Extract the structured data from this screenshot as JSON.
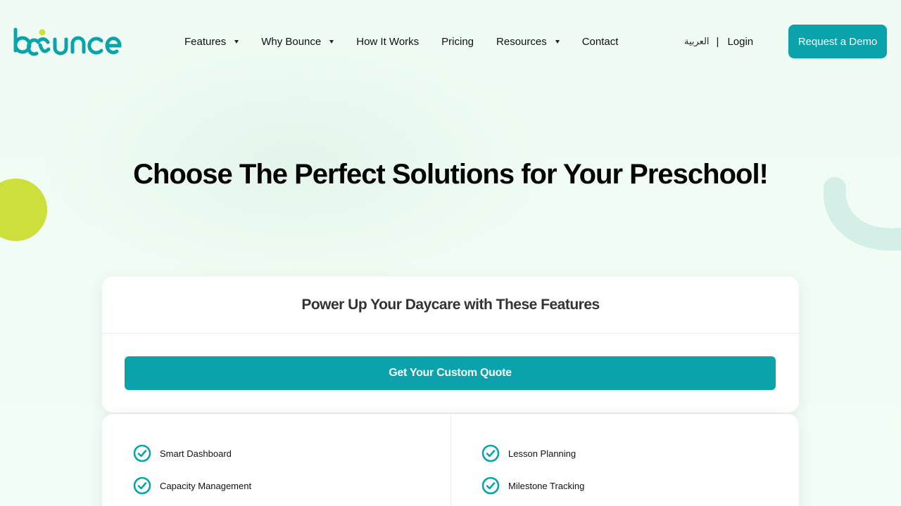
{
  "brand": {
    "logo_text": "bounce",
    "accent_color": "#0aa3ab",
    "dot_color": "#cddf3d"
  },
  "nav": {
    "items": [
      {
        "label": "Features",
        "has_dropdown": true
      },
      {
        "label": "Why Bounce",
        "has_dropdown": true
      },
      {
        "label": "How It Works",
        "has_dropdown": false
      },
      {
        "label": "Pricing",
        "has_dropdown": false
      },
      {
        "label": "Resources",
        "has_dropdown": true
      },
      {
        "label": "Contact",
        "has_dropdown": false
      }
    ],
    "language": "العربية",
    "separator": "|",
    "login": "Login",
    "cta": "Request a Demo"
  },
  "hero": {
    "title": "Choose The Perfect Solutions for Your Preschool!"
  },
  "pricing_card": {
    "heading": "Power Up Your Daycare with These Features",
    "button": "Get Your Custom Quote"
  },
  "features": {
    "left": [
      "Smart Dashboard",
      "Capacity Management"
    ],
    "right": [
      "Lesson Planning",
      "Milestone Tracking"
    ],
    "icon": "check-circle-icon"
  }
}
